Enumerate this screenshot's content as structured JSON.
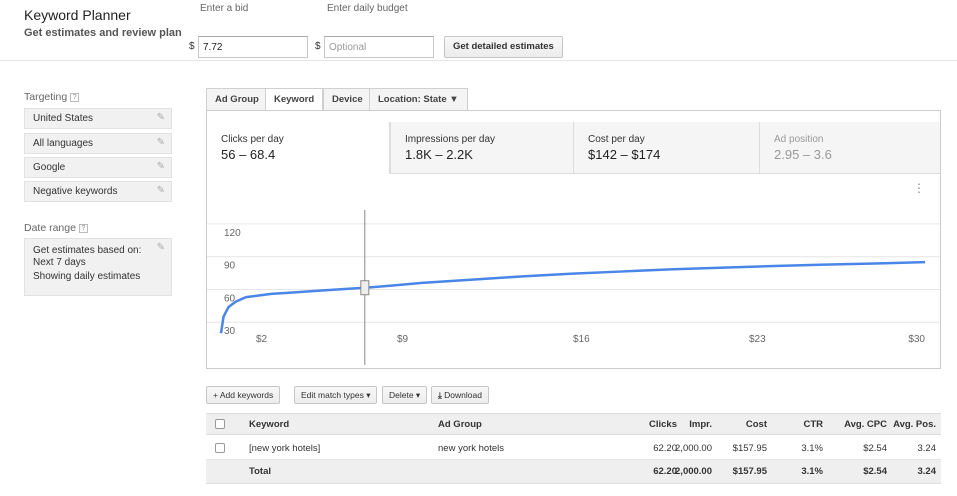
{
  "header": {
    "title": "Keyword Planner",
    "subtitle": "Get estimates and review plan",
    "bid_label": "Enter a bid",
    "bid_currency": "$",
    "bid_value": "7.72",
    "budget_label": "Enter daily budget",
    "budget_currency": "$",
    "budget_placeholder": "Optional",
    "detailed_button": "Get detailed estimates"
  },
  "sidebar": {
    "targeting_label": "Targeting",
    "help": "?",
    "items": [
      {
        "label": "United States"
      },
      {
        "label": "All languages"
      },
      {
        "label": "Google"
      },
      {
        "label": "Negative keywords"
      }
    ],
    "date_range_label": "Date range",
    "date_line1": "Get estimates based on:",
    "date_line2": "Next 7 days",
    "date_line3": "Showing daily estimates"
  },
  "tabs": [
    {
      "label": "Ad Group"
    },
    {
      "label": "Keyword"
    },
    {
      "label": "Device"
    },
    {
      "label": "Location: State ▼"
    }
  ],
  "metrics": [
    {
      "label": "Clicks per day",
      "value": "56 – 68.4"
    },
    {
      "label": "Impressions per day",
      "value": "1.8K – 2.2K"
    },
    {
      "label": "Cost per day",
      "value": "$142 – $174"
    },
    {
      "label": "Ad position",
      "value": "2.95 – 3.6"
    }
  ],
  "chart_data": {
    "type": "line",
    "y_ticks": [
      "120",
      "90",
      "60",
      "30"
    ],
    "x_ticks": [
      "$2",
      "$9",
      "$16",
      "$23",
      "$30"
    ],
    "ylim": [
      0,
      130
    ],
    "xlim": [
      2,
      30
    ],
    "x": [
      2,
      2.1,
      2.3,
      2.6,
      3,
      4,
      5,
      6,
      7,
      8,
      9,
      10,
      12,
      14,
      16,
      18,
      20,
      22,
      24,
      26,
      28,
      30
    ],
    "y": [
      20,
      35,
      44,
      49,
      53,
      56,
      57.5,
      59,
      60.5,
      62,
      64,
      66,
      69,
      72,
      74.5,
      76.5,
      78.5,
      80,
      81.5,
      82.7,
      83.8,
      85
    ],
    "cursor_x": 7.72,
    "line_color": "#4a86e8"
  },
  "table": {
    "buttons": {
      "add": "+ Add keywords",
      "match": "Edit match types ▾",
      "delete": "Delete ▾",
      "download": "Download"
    },
    "headers": {
      "keyword": "Keyword",
      "ad_group": "Ad Group",
      "clicks": "Clicks",
      "impr": "Impr.",
      "cost": "Cost",
      "ctr": "CTR",
      "cpc": "Avg. CPC",
      "pos": "Avg. Pos."
    },
    "row": {
      "keyword": "[new york hotels]",
      "ad_group": "new york hotels",
      "clicks": "62.20",
      "impr": "2,000.00",
      "cost": "$157.95",
      "ctr": "3.1%",
      "cpc": "$2.54",
      "pos": "3.24"
    },
    "total": {
      "label": "Total",
      "clicks": "62.20",
      "impr": "2,000.00",
      "cost": "$157.95",
      "ctr": "3.1%",
      "cpc": "$2.54",
      "pos": "3.24"
    }
  }
}
